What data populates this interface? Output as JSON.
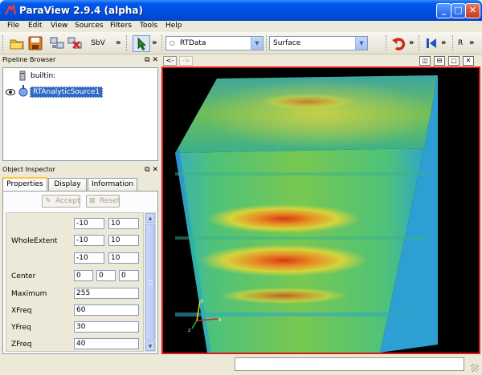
{
  "window": {
    "title": "ParaView 2.9.4 (alpha)",
    "controls": {
      "minimize": "_",
      "maximize": "□",
      "close": "✕"
    }
  },
  "menu": {
    "items": [
      "File",
      "Edit",
      "View",
      "Sources",
      "Filters",
      "Tools",
      "Help"
    ]
  },
  "toolbar": {
    "sbv_label": "SbV",
    "more": "»",
    "array_combo": "RTData",
    "representation_combo": "Surface",
    "reset_label": "R"
  },
  "pipeline_browser": {
    "title": "Pipeline Browser",
    "items": [
      {
        "label": "builtin:"
      },
      {
        "label": "RTAnalyticSource1"
      }
    ]
  },
  "view": {
    "back": "<-",
    "forward": "->"
  },
  "object_inspector": {
    "title": "Object Inspector",
    "tabs": [
      "Properties",
      "Display",
      "Information"
    ],
    "accept_label": "Accept",
    "reset_label": "Reset",
    "properties": {
      "whole_extent_label": "WholeExtent",
      "whole_extent": [
        [
          "-10",
          "10"
        ],
        [
          "-10",
          "10"
        ],
        [
          "-10",
          "10"
        ]
      ],
      "center_label": "Center",
      "center": [
        "0",
        "0",
        "0"
      ],
      "maximum_label": "Maximum",
      "maximum": "255",
      "xfreq_label": "XFreq",
      "xfreq": "60",
      "yfreq_label": "YFreq",
      "yfreq": "30",
      "zfreq_label": "ZFreq",
      "zfreq": "40"
    }
  },
  "colors": {
    "titlebar": "#0055e5",
    "view_border": "#e01818",
    "accent": "#316ac5"
  }
}
